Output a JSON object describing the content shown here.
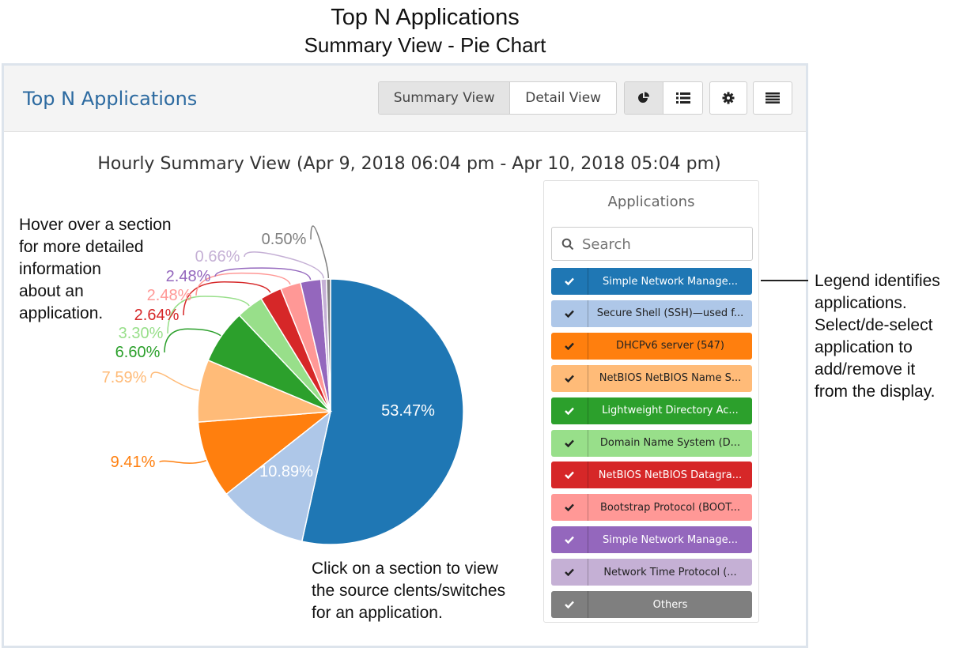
{
  "doc": {
    "title": "Top N Applications",
    "subtitle": "Summary View - Pie Chart"
  },
  "header": {
    "title": "Top N Applications",
    "summary_view_label": "Summary View",
    "detail_view_label": "Detail View",
    "icons": [
      "pie-chart-icon",
      "list-icon",
      "gear-icon",
      "menu-icon"
    ]
  },
  "chart_title": "Hourly Summary View (Apr 9, 2018 06:04 pm - Apr 10, 2018 05:04 pm)",
  "annotations": {
    "hover": [
      "Hover over a section",
      "for more detailed",
      "information",
      "about an",
      "application."
    ],
    "click": [
      "Click on a section to view",
      "the source clents/switches",
      "for an application."
    ],
    "legend": [
      "Legend identifies",
      "applications.",
      "Select/de-select",
      "application to",
      "add/remove it",
      "from the display."
    ]
  },
  "legend": {
    "title": "Applications",
    "search_placeholder": "Search",
    "items": [
      {
        "label": "Simple Network Manage...",
        "color": "#1f77b4",
        "text_color": "#ffffff"
      },
      {
        "label": "Secure Shell (SSH)—used f...",
        "color": "#aec7e8",
        "text_color": "#222222"
      },
      {
        "label": "DHCPv6 server (547)",
        "color": "#ff7f0e",
        "text_color": "#222222"
      },
      {
        "label": "NetBIOS NetBIOS Name S...",
        "color": "#ffbb78",
        "text_color": "#222222"
      },
      {
        "label": "Lightweight Directory Ac...",
        "color": "#2ca02c",
        "text_color": "#ffffff"
      },
      {
        "label": "Domain Name System (D...",
        "color": "#98df8a",
        "text_color": "#222222"
      },
      {
        "label": "NetBIOS NetBIOS Datagra...",
        "color": "#d62728",
        "text_color": "#ffffff"
      },
      {
        "label": "Bootstrap Protocol (BOOT...",
        "color": "#ff9896",
        "text_color": "#222222"
      },
      {
        "label": "Simple Network Manage...",
        "color": "#9467bd",
        "text_color": "#ffffff"
      },
      {
        "label": "Network Time Protocol (...",
        "color": "#c5b0d5",
        "text_color": "#222222"
      },
      {
        "label": "Others",
        "color": "#7f7f7f",
        "text_color": "#ffffff"
      }
    ]
  },
  "chart_data": {
    "type": "pie",
    "title": "Hourly Summary View (Apr 9, 2018 06:04 pm - Apr 10, 2018 05:04 pm)",
    "slices": [
      {
        "label": "53.47%",
        "value": 53.47,
        "color": "#1f77b4"
      },
      {
        "label": "10.89%",
        "value": 10.89,
        "color": "#aec7e8"
      },
      {
        "label": "9.41%",
        "value": 9.41,
        "color": "#ff7f0e"
      },
      {
        "label": "7.59%",
        "value": 7.59,
        "color": "#ffbb78"
      },
      {
        "label": "6.60%",
        "value": 6.6,
        "color": "#2ca02c"
      },
      {
        "label": "3.30%",
        "value": 3.3,
        "color": "#98df8a"
      },
      {
        "label": "2.64%",
        "value": 2.64,
        "color": "#d62728"
      },
      {
        "label": "2.48%",
        "value": 2.48,
        "color": "#ff9896"
      },
      {
        "label": "2.48%",
        "value": 2.48,
        "color": "#9467bd"
      },
      {
        "label": "0.66%",
        "value": 0.66,
        "color": "#c5b0d5"
      },
      {
        "label": "0.50%",
        "value": 0.5,
        "color": "#7f7f7f"
      }
    ]
  }
}
